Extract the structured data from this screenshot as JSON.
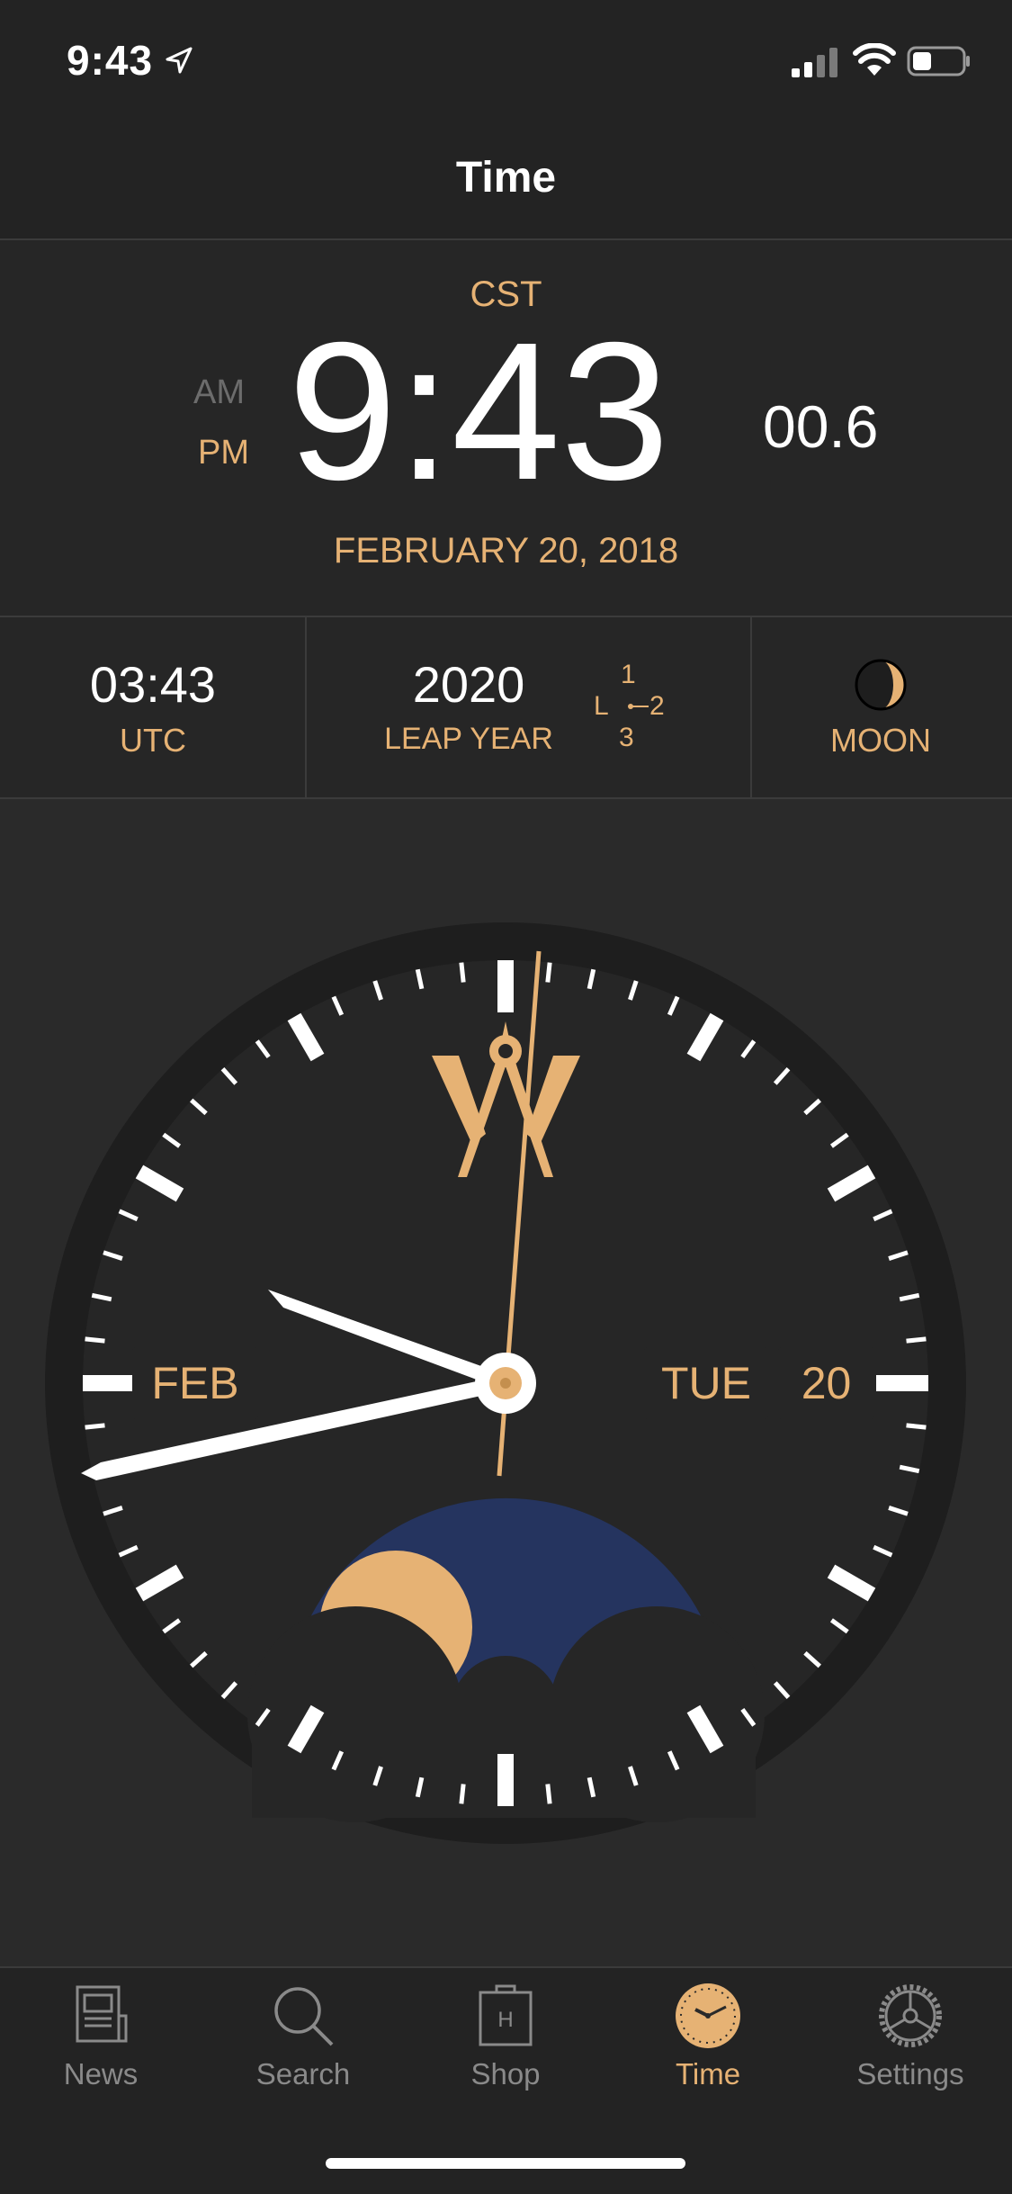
{
  "status_bar": {
    "time": "9:43",
    "icons": [
      "location-arrow-icon",
      "signal-icon",
      "wifi-icon",
      "battery-icon"
    ]
  },
  "nav": {
    "title": "Time"
  },
  "time_display": {
    "timezone": "CST",
    "am": "AM",
    "pm": "PM",
    "time": "9:43",
    "seconds": "00.6",
    "date": "FEBRUARY 20, 2018"
  },
  "info": {
    "utc_time": "03:43",
    "utc_label": "UTC",
    "leap_year": "2020",
    "leap_label": "LEAP YEAR",
    "leap_l": "L",
    "leap_1": "1",
    "leap_2": "2",
    "leap_3": "3",
    "moon_label": "MOON"
  },
  "watch": {
    "month": "FEB",
    "weekday": "TUE",
    "day": "20"
  },
  "tabs": [
    {
      "label": "News",
      "icon": "newspaper-icon"
    },
    {
      "label": "Search",
      "icon": "search-icon"
    },
    {
      "label": "Shop",
      "icon": "shopping-bag-icon"
    },
    {
      "label": "Time",
      "icon": "clock-icon",
      "active": true
    },
    {
      "label": "Settings",
      "icon": "gear-icon"
    }
  ],
  "colors": {
    "accent": "#e6b274",
    "background": "#2a2a2a",
    "moon_sky": "#25345f",
    "inactive": "#8a8a8a"
  }
}
